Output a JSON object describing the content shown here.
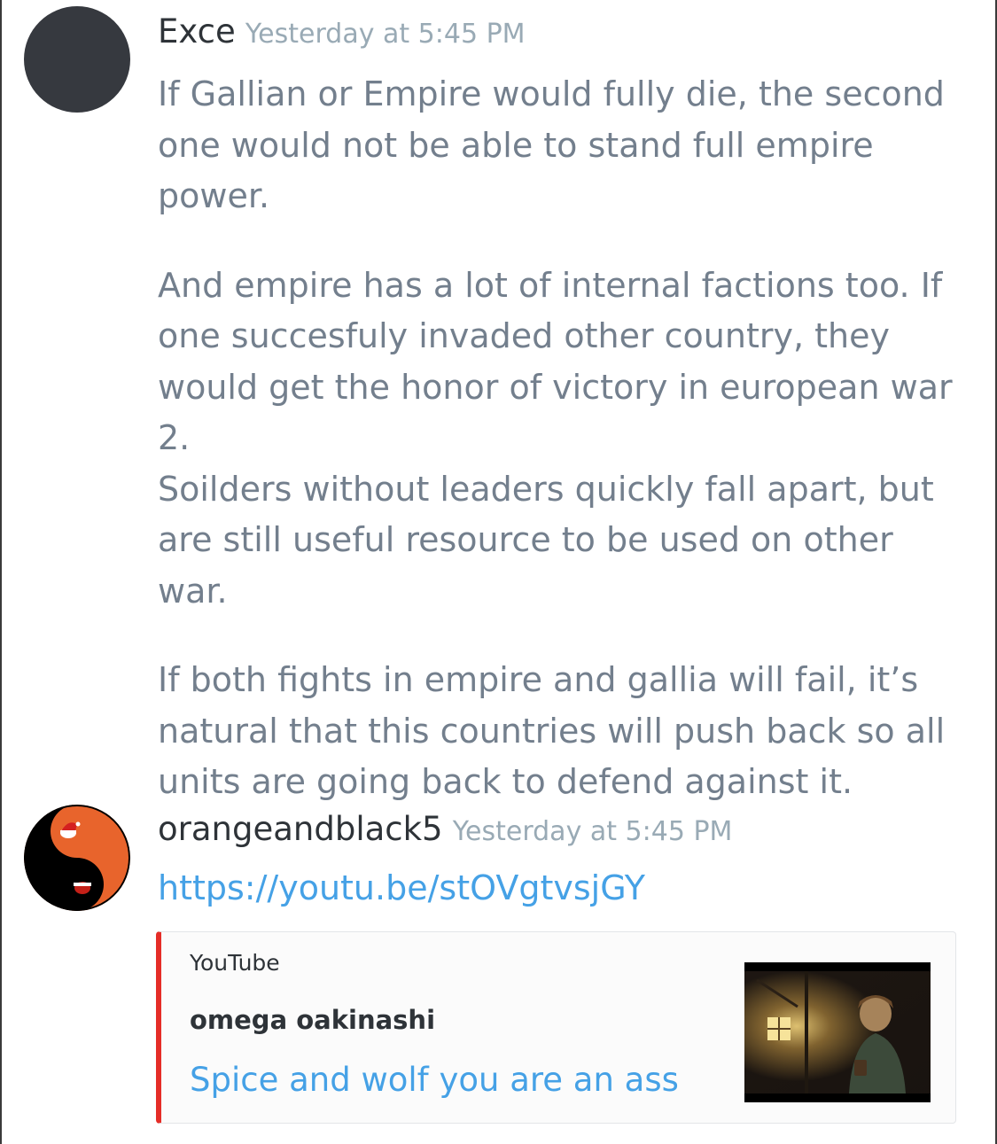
{
  "messages": [
    {
      "username": "Exce",
      "timestamp": "Yesterday at 5:45 PM",
      "paragraphs": [
        [
          "If Gallian or Empire would fully die, the second one would not be able to stand full empire power."
        ],
        [
          "And empire has a lot of internal factions too. If one succesfuly invaded other country, they would get the honor of victory in european war 2.",
          "Soilders without leaders quickly fall apart, but are still useful resource to be used on other war."
        ],
        [
          "If both fights in empire and gallia will fail, it’s natural that this countries will push back so all units are going back to defend against it."
        ]
      ]
    },
    {
      "username": "orangeandblack5",
      "timestamp": "Yesterday at 5:45 PM",
      "link": "https://youtu.be/stOVgtvsjGY",
      "embed": {
        "provider": "YouTube",
        "author": "omega oakinashi",
        "title": "Spice and wolf you are an ass",
        "border_color": "#e52d27"
      }
    }
  ],
  "colors": {
    "text_gray": "#737f8d",
    "username": "#2e3338",
    "timestamp": "#99aab5",
    "link": "#45a1e6",
    "avatar_dark": "#36393f",
    "yin_yang_orange": "#e8642c"
  },
  "icons": {
    "avatar_1": "dark-circle-avatar",
    "avatar_2": "yin-yang-santa-hat-avatar",
    "embed_thumbnail": "video-thumbnail-anime-scene"
  }
}
